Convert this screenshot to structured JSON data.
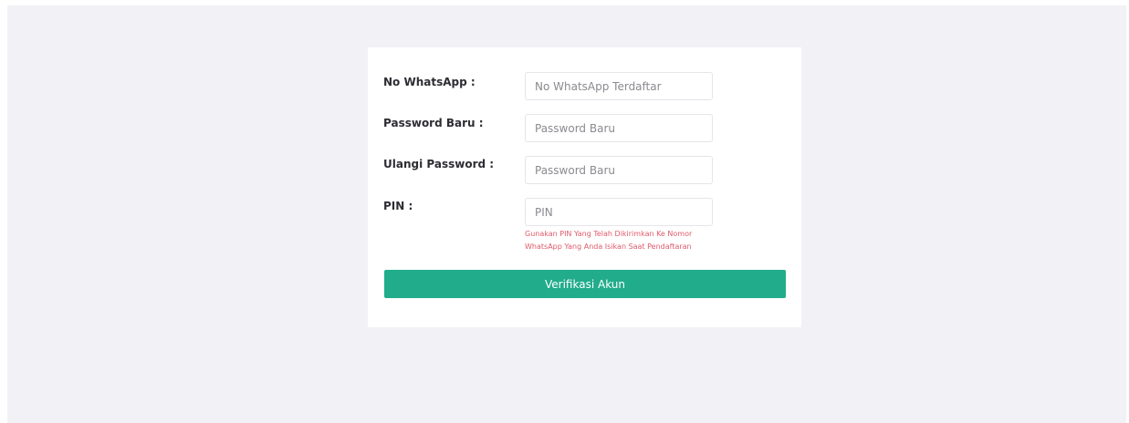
{
  "form": {
    "whatsapp": {
      "label": "No WhatsApp :",
      "placeholder": "No WhatsApp Terdaftar",
      "value": ""
    },
    "new_password": {
      "label": "Password Baru :",
      "placeholder": "Password Baru",
      "value": ""
    },
    "repeat_password": {
      "label": "Ulangi Password :",
      "placeholder": "Password Baru",
      "value": ""
    },
    "pin": {
      "label": "PIN :",
      "placeholder": "PIN",
      "value": "",
      "help_lines": [
        "Gunakan PIN Yang Telah Dikirimkan Ke Nomor",
        "WhatsApp Yang Anda Isikan Saat Pendaftaran"
      ]
    },
    "submit_label": "Verifikasi Akun"
  },
  "colors": {
    "page_background": "#f2f2f6",
    "card_background": "#ffffff",
    "button": "#21ac8b",
    "help_text": "#de5b6b"
  }
}
